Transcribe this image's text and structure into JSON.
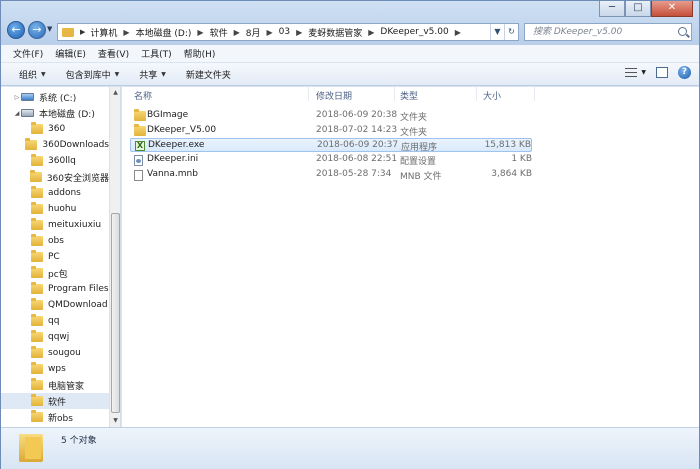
{
  "address": {
    "breadcrumbs": [
      "计算机",
      "本地磁盘 (D:)",
      "软件",
      "8月",
      "03",
      "麦蚜数据管家",
      "DKeeper_v5.00"
    ]
  },
  "search": {
    "placeholder": "搜索 DKeeper_v5.00"
  },
  "window_buttons": {
    "minimize": "─",
    "maximize": "□",
    "close": "✕"
  },
  "menu": [
    "文件(F)",
    "编辑(E)",
    "查看(V)",
    "工具(T)",
    "帮助(H)"
  ],
  "toolbar": {
    "organize": "组织",
    "include": "包含到库中",
    "share": "共享",
    "new_folder": "新建文件夹"
  },
  "nav_pane": {
    "items": [
      {
        "label": "系统 (C:)",
        "icon": "drive-icon"
      },
      {
        "label": "本地磁盘 (D:)",
        "icon": "drive-icon"
      },
      {
        "label": "360"
      },
      {
        "label": "360Downloads"
      },
      {
        "label": "360llq"
      },
      {
        "label": "360安全浏览器"
      },
      {
        "label": "addons"
      },
      {
        "label": "huohu"
      },
      {
        "label": "meituxiuxiu"
      },
      {
        "label": "obs"
      },
      {
        "label": "PC"
      },
      {
        "label": "pc包"
      },
      {
        "label": "Program Files"
      },
      {
        "label": "QMDownload"
      },
      {
        "label": "qq"
      },
      {
        "label": "qqwj"
      },
      {
        "label": "sougou"
      },
      {
        "label": "wps"
      },
      {
        "label": "电脑管家"
      },
      {
        "label": "软件"
      },
      {
        "label": "新obs"
      }
    ]
  },
  "file_list": {
    "columns": [
      "名称",
      "修改日期",
      "类型",
      "大小"
    ],
    "rows": [
      {
        "name": "BGImage",
        "date": "2018-06-09 20:38",
        "type": "文件夹",
        "size": ""
      },
      {
        "name": "DKeeper_V5.00",
        "date": "2018-07-02 14:23",
        "type": "文件夹",
        "size": ""
      },
      {
        "name": "DKeeper.exe",
        "date": "2018-06-09 20:37",
        "type": "应用程序",
        "size": "15,813 KB"
      },
      {
        "name": "DKeeper.ini",
        "date": "2018-06-08 22:51",
        "type": "配置设置",
        "size": "1 KB"
      },
      {
        "name": "Vanna.mnb",
        "date": "2018-05-28 7:34",
        "type": "MNB 文件",
        "size": "3,864 KB"
      }
    ]
  },
  "status": {
    "count": "5 个对象"
  }
}
